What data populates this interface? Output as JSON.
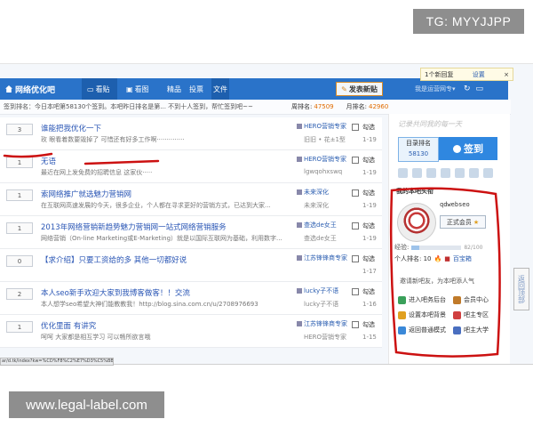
{
  "watermarks": {
    "top": "TG: MYYJJPP",
    "bottom": "www.legal-label.com"
  },
  "topbar": {
    "logo": "网络优化吧",
    "tabs": [
      {
        "label": "看贴",
        "icon": "chat-icon"
      },
      {
        "label": "看图",
        "icon": "image-icon"
      },
      {
        "label": "精品"
      },
      {
        "label": "投票"
      },
      {
        "label": "文件"
      }
    ],
    "post_button": "发表新贴",
    "user_link": "我是运营网专▾",
    "popup": {
      "text": "1个新回复",
      "settings": "设置",
      "close": "×"
    }
  },
  "signbar": {
    "tip": "签到排名：今日本吧第58130个签到。本吧昨日排名是第... 不到十人签到，帮忙签到吧~~",
    "week_label": "周排名:",
    "week_rank": "47509",
    "month_label": "月排名:",
    "month_rank": "42960"
  },
  "threads": [
    {
      "replies": "3",
      "title": "谁能把我优化一下",
      "desc": "玫  眼看着数要毁掉了  可惜还有好多工作啊··············",
      "author": "HERO营销专家",
      "last": "旧旧 • 花±1型",
      "date": "1-19"
    },
    {
      "replies": "1",
      "title": "无语",
      "desc": "最近在网上发免费的招聘信息  这家伙·····",
      "author": "HERO营销专家",
      "last": "lgwqohxswq",
      "date": "1-19"
    },
    {
      "replies": "1",
      "title": "索网络推广就选魅力营销网",
      "desc": "在互联网高速发展的今天，很多企业，个人都在寻求更好的营销方式，已达到大家...",
      "author": "未来深化",
      "last": "未来深化",
      "date": "1-19"
    },
    {
      "replies": "1",
      "title": "2013年网络营销新趋势魅力营销网一站式网络营销服务",
      "desc": "网络营销（On-line Marketing或E-Marketing）就是以国际互联网为基础，利用数字...",
      "author": "查选de女王",
      "last": "查选de女王",
      "date": "1-19"
    },
    {
      "replies": "0",
      "title": "【求介绍】只要工资给的多  其他一切都好说",
      "desc": "",
      "author": "江苏锋锋商专家",
      "last": "",
      "date": "1-17"
    },
    {
      "replies": "2",
      "title": "本人seo新手欢迎大家到我博客做客！！交流",
      "desc": "本人想学seo希望大神们能教教我！http://blog.sina.com.cn/u/2708976693",
      "author": "lucky子不语",
      "last": "lucky子不语",
      "date": "1-16"
    },
    {
      "replies": "1",
      "title": "优化里面  有讲究",
      "desc": "呵呵  大家都是相互学习  可以畅所欲言哦",
      "author": "江苏锋锋商专家",
      "last": "HERO营销专家",
      "date": "1-15"
    }
  ],
  "sidebar": {
    "slogan": "记录共同我的每一天",
    "rank_label": "目录排名",
    "rank_num": "58130",
    "sign_button": "签到",
    "my_section": "我的本吧头衔",
    "username": "qdwebseo",
    "member": "正式会员",
    "exp_label": "经验:",
    "exp_value": "82/100",
    "personal_rank": "个人排名: 10",
    "badge": "百宝箱",
    "invite": "邀请新吧友，为本吧添人气",
    "menu": [
      {
        "label": "进入吧务后台",
        "color": "#3aa05a"
      },
      {
        "label": "会员中心",
        "color": "#c07a2a"
      },
      {
        "label": "设置本吧背景",
        "color": "#e0a020"
      },
      {
        "label": "吧主专区",
        "color": "#d04040"
      },
      {
        "label": "返回普通模式",
        "color": "#3a88d8"
      },
      {
        "label": "吧主大学",
        "color": "#4a6fc0"
      }
    ]
  },
  "right_tab": "返回顶部",
  "statusbar": "ar/d.tk/index?kw=%CD%F8%C2%E7%D3%C5%BB%AF"
}
